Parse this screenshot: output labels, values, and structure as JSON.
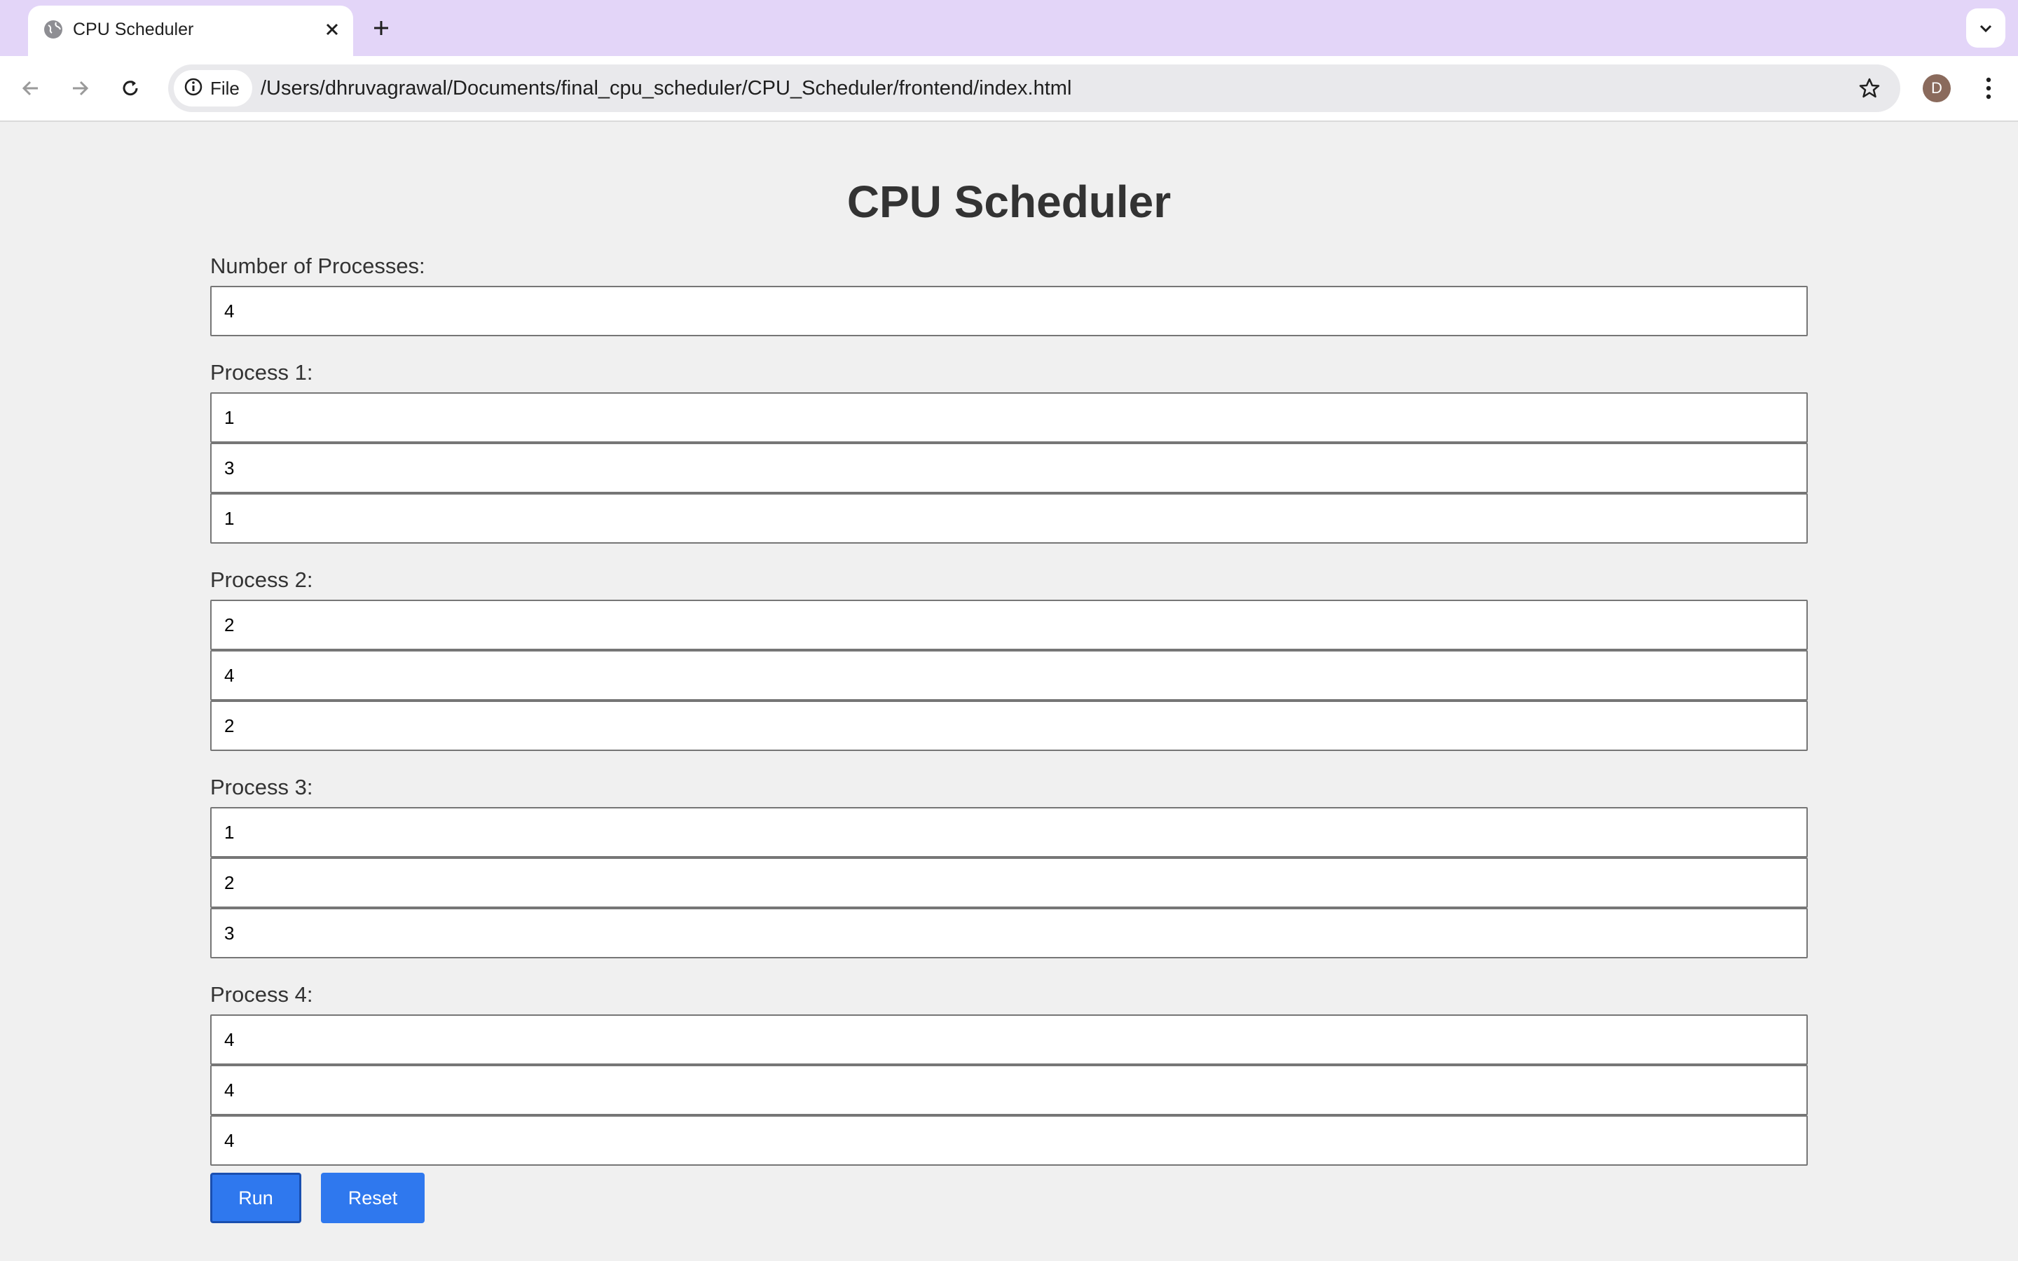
{
  "browser": {
    "tab_title": "CPU Scheduler",
    "omnibox_chip_label": "File",
    "url": "/Users/dhruvagrawal/Documents/final_cpu_scheduler/CPU_Scheduler/frontend/index.html",
    "profile_initial": "D"
  },
  "page": {
    "title": "CPU Scheduler",
    "num_processes_label": "Number of Processes:",
    "num_processes_value": "4",
    "processes": [
      {
        "label": "Process 1:",
        "values": [
          "1",
          "3",
          "1"
        ]
      },
      {
        "label": "Process 2:",
        "values": [
          "2",
          "4",
          "2"
        ]
      },
      {
        "label": "Process 3:",
        "values": [
          "1",
          "2",
          "3"
        ]
      },
      {
        "label": "Process 4:",
        "values": [
          "4",
          "4",
          "4"
        ]
      }
    ],
    "run_label": "Run",
    "reset_label": "Reset"
  },
  "colors": {
    "tabstrip": "#e3d5f8",
    "page_background": "#f0f0f0",
    "button": "#2f78ee",
    "avatar": "#8a6a5c"
  },
  "icons": [
    "globe-icon",
    "close-icon",
    "plus-icon",
    "chevron-down-icon",
    "back-arrow-icon",
    "forward-arrow-icon",
    "reload-icon",
    "info-icon",
    "star-icon",
    "kebab-menu-icon"
  ]
}
